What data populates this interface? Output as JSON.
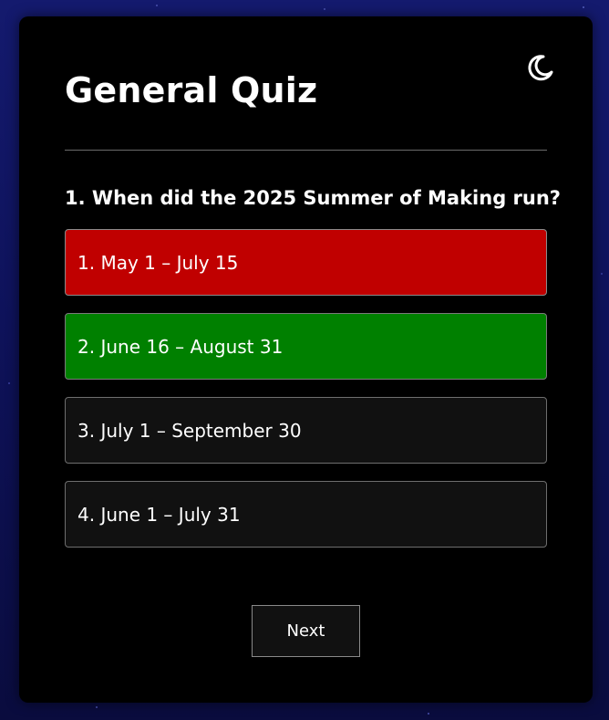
{
  "quiz": {
    "title": "General Quiz",
    "question": "1. When did the 2025 Summer of Making run?",
    "answers": [
      {
        "label": "1. May 1 – July 15",
        "state": "wrong"
      },
      {
        "label": "2. June 16 – August 31",
        "state": "correct"
      },
      {
        "label": "3. July 1 – September 30",
        "state": "neutral"
      },
      {
        "label": "4. June 1 – July 31",
        "state": "neutral"
      }
    ],
    "next_label": "Next",
    "theme_icon": "moon-icon"
  },
  "colors": {
    "wrong": "#c00000",
    "correct": "#008000",
    "neutral": "#111111",
    "card": "#000000"
  }
}
